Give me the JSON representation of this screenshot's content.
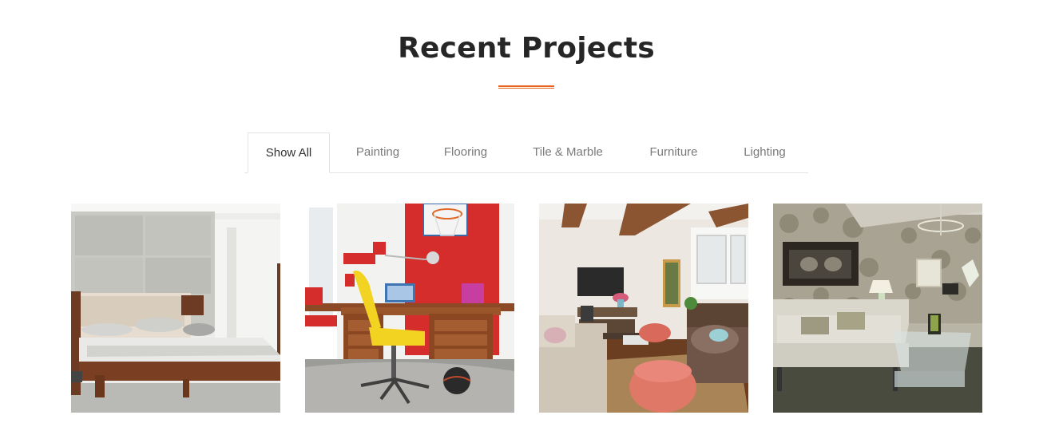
{
  "section": {
    "title": "Recent Projects"
  },
  "colors": {
    "accent": "#e8641c",
    "heading": "#262626",
    "tab_text": "#7a7a7a"
  },
  "filters": [
    {
      "label": "Show All",
      "active": true
    },
    {
      "label": "Painting",
      "active": false
    },
    {
      "label": "Flooring",
      "active": false
    },
    {
      "label": "Tile & Marble",
      "active": false
    },
    {
      "label": "Furniture",
      "active": false
    },
    {
      "label": "Lighting",
      "active": false
    }
  ],
  "projects": [
    {
      "image": "bedroom-photo"
    },
    {
      "image": "home-office-photo"
    },
    {
      "image": "living-room-photo"
    },
    {
      "image": "lounge-photo"
    }
  ]
}
